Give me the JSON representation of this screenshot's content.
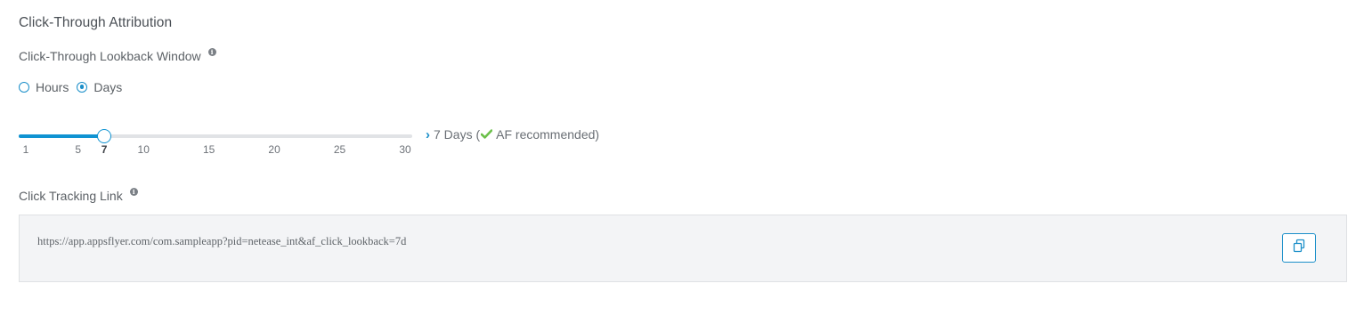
{
  "section": {
    "title": "Click-Through Attribution"
  },
  "lookback": {
    "label": "Click-Through Lookback Window",
    "info_icon": "info-icon",
    "unit_options": [
      {
        "label": "Hours",
        "selected": false
      },
      {
        "label": "Days",
        "selected": true
      }
    ],
    "slider": {
      "min": 1,
      "max": 30,
      "value": 7,
      "tick_labels": [
        "1",
        "5",
        "7",
        "10",
        "15",
        "20",
        "25",
        "30"
      ],
      "accent_color": "#0f93d2"
    },
    "value_text": "7 Days (",
    "recommended_text": "AF recommended)",
    "chevron_icon": "chevron-right-icon",
    "check_icon": "check-icon",
    "check_color": "#6cc04a"
  },
  "tracking": {
    "label": "Click Tracking Link",
    "info_icon": "info-icon",
    "url": "https://app.appsflyer.com/com.sampleapp?pid=netease_int&af_click_lookback=7d",
    "copy_icon": "copy-icon"
  }
}
